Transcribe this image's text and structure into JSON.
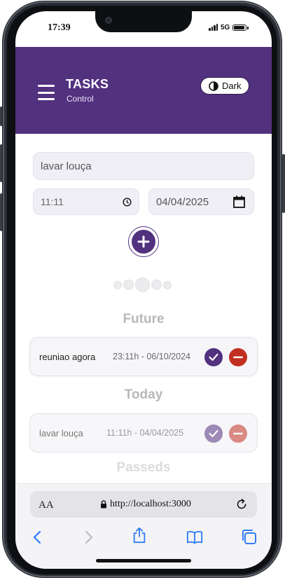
{
  "status_bar": {
    "time": "17:39",
    "network": "5G",
    "battery_level": 0.9
  },
  "header": {
    "title": "TASKS",
    "subtitle": "Control",
    "theme_button": {
      "label": "Dark",
      "icon": "contrast-icon"
    },
    "menu_icon": "hamburger-menu-icon",
    "background": "#52317f"
  },
  "form": {
    "task_input": {
      "value": "lavar louça"
    },
    "time_input": {
      "value": "11:11",
      "icon": "clock-icon"
    },
    "date_input": {
      "value": "04/04/2025",
      "icon": "calendar-icon"
    },
    "add_button": {
      "icon": "plus-icon"
    }
  },
  "sections": {
    "future": {
      "title": "Future",
      "tasks": [
        {
          "name": "reuniao agora",
          "datetime": "23:11h - 06/10/2024"
        }
      ]
    },
    "today": {
      "title": "Today",
      "tasks": [
        {
          "name": "lavar louça",
          "datetime": "11:11h - 04/04/2025"
        }
      ]
    },
    "passeds": {
      "title": "Passeds"
    }
  },
  "browser": {
    "text_size_label": "AA",
    "url": "http://localhost:3000",
    "icons": [
      "back-icon",
      "forward-icon",
      "share-icon",
      "bookmarks-icon",
      "tabs-icon"
    ]
  },
  "colors": {
    "accent": "#52317f",
    "danger": "#c22f22",
    "link": "#2f7cf6"
  }
}
